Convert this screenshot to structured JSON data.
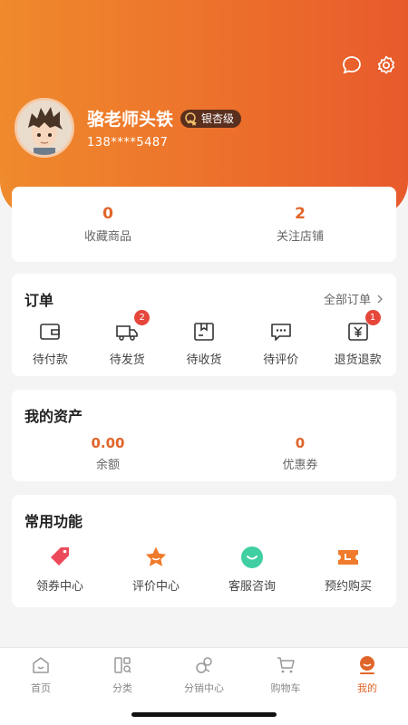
{
  "profile": {
    "username": "骆老师头铁",
    "level_badge": "银杏级",
    "phone": "138****5487"
  },
  "header_icons": [
    "message-icon",
    "settings-icon"
  ],
  "favorites": {
    "collected_count": "0",
    "collected_label": "收藏商品",
    "followed_count": "2",
    "followed_label": "关注店铺"
  },
  "orders": {
    "title": "订单",
    "all_label": "全部订单",
    "items": [
      {
        "label": "待付款",
        "icon": "wallet-icon",
        "badge": ""
      },
      {
        "label": "待发货",
        "icon": "truck-icon",
        "badge": "2"
      },
      {
        "label": "待收货",
        "icon": "package-icon",
        "badge": ""
      },
      {
        "label": "待评价",
        "icon": "comment-icon",
        "badge": ""
      },
      {
        "label": "退货退款",
        "icon": "refund-icon",
        "badge": "1"
      }
    ]
  },
  "assets": {
    "title": "我的资产",
    "balance_value": "0.00",
    "balance_label": "余额",
    "coupon_value": "0",
    "coupon_label": "优惠券"
  },
  "functions": {
    "title": "常用功能",
    "items": [
      {
        "label": "领券中心",
        "icon": "coupon-tag-icon"
      },
      {
        "label": "评价中心",
        "icon": "star-icon"
      },
      {
        "label": "客服咨询",
        "icon": "customer-service-icon"
      },
      {
        "label": "预约购买",
        "icon": "ticket-icon"
      }
    ]
  },
  "tabbar": {
    "items": [
      {
        "label": "首页",
        "icon": "home-icon"
      },
      {
        "label": "分类",
        "icon": "category-icon"
      },
      {
        "label": "分销中心",
        "icon": "distribution-icon"
      },
      {
        "label": "购物车",
        "icon": "cart-icon"
      },
      {
        "label": "我的",
        "icon": "profile-icon"
      }
    ],
    "active_index": 4
  },
  "colors": {
    "accent": "#e0652a",
    "header_gradient_start": "#ef8a2d",
    "header_gradient_end": "#e85a2c",
    "badge_red": "#e5473a"
  }
}
